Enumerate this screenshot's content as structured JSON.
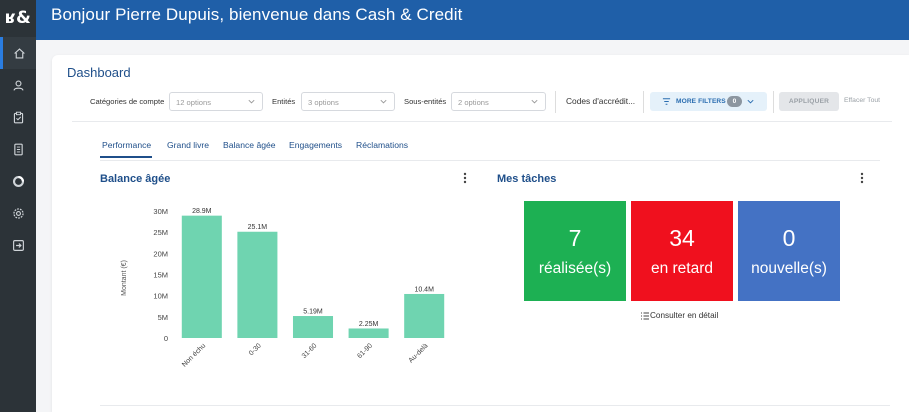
{
  "app": {
    "welcome_title": "Bonjour Pierre Dupuis, bienvenue dans Cash & Credit",
    "logo_text": "ʁ&"
  },
  "sidebar": {
    "items": [
      {
        "icon": "home-icon",
        "active": true
      },
      {
        "icon": "user-icon",
        "active": false
      },
      {
        "icon": "clipboard-icon",
        "active": false
      },
      {
        "icon": "document-icon",
        "active": false
      },
      {
        "icon": "chart-ring-icon",
        "active": false
      },
      {
        "icon": "settings-icon",
        "active": false
      },
      {
        "icon": "logout-icon",
        "active": false
      }
    ]
  },
  "page": {
    "title": "Dashboard"
  },
  "filters": {
    "categories_label": "Catégories de compte",
    "categories_placeholder": "12 options",
    "entites_label": "Entités",
    "entites_placeholder": "3 options",
    "sous_entites_label": "Sous-entités",
    "sous_entites_placeholder": "2 options",
    "codes_label": "Codes d'accrédit...",
    "more_filters_label": "MORE FILTERS",
    "more_filters_count": "0",
    "apply_label": "APPLIQUER",
    "clear_label": "Effacer Tout"
  },
  "tabs": [
    {
      "label": "Performance",
      "active": true
    },
    {
      "label": "Grand livre",
      "active": false
    },
    {
      "label": "Balance âgée",
      "active": false
    },
    {
      "label": "Engagements",
      "active": false
    },
    {
      "label": "Réclamations",
      "active": false
    }
  ],
  "balance_widget": {
    "title": "Balance âgée"
  },
  "tasks_widget": {
    "title": "Mes tâches",
    "tiles": [
      {
        "count": "7",
        "label": "réalisée(s)",
        "color": "#1db053"
      },
      {
        "count": "34",
        "label": "en retard",
        "color": "#f0101e"
      },
      {
        "count": "0",
        "label": "nouvelle(s)",
        "color": "#4472c4"
      }
    ],
    "consult_link": "Consulter en détail"
  },
  "chart_data": {
    "type": "bar",
    "title": "",
    "xlabel": "",
    "ylabel": "Montant (€)",
    "categories": [
      "Non échu",
      "0-30",
      "31-60",
      "61-90",
      "Au-delà"
    ],
    "values": [
      28.9,
      25.1,
      5.19,
      2.25,
      10.4
    ],
    "data_labels": [
      "28.9M",
      "25.1M",
      "5.19M",
      "2.25M",
      "10.4M"
    ],
    "yticks": [
      "0",
      "5M",
      "10M",
      "15M",
      "20M",
      "25M",
      "30M"
    ],
    "ylim": [
      0,
      30
    ],
    "bar_color": "#6fd4b0",
    "grid": false,
    "legend": false
  }
}
